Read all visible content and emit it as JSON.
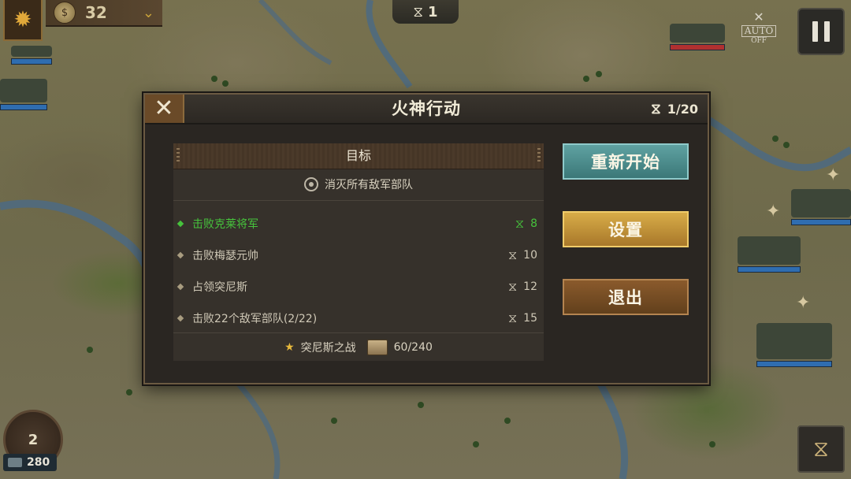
{
  "hud": {
    "coins": "32",
    "turn": "1",
    "auto_label": "AUTO",
    "auto_state": "OFF",
    "level": "2",
    "bottom_count": "280"
  },
  "icons": {
    "sun": "sun-icon",
    "coin": "coin-icon",
    "chevron": "chevron-down-icon",
    "hourglass": "hourglass-icon",
    "rifles": "crossed-rifles-icon",
    "pause": "pause-icon",
    "close": "close-icon",
    "target": "target-icon",
    "star": "star-icon",
    "chest": "chest-icon"
  },
  "dialog": {
    "title": "火神行动",
    "turns": "1/20",
    "objectives_header": "目标",
    "main_objective": "消灭所有敌军部队",
    "objectives": [
      {
        "label": "击败克莱将军",
        "turn": "8",
        "done": true
      },
      {
        "label": "击败梅瑟元帅",
        "turn": "10",
        "done": false
      },
      {
        "label": "占领突尼斯",
        "turn": "12",
        "done": false
      },
      {
        "label": "击败22个敌军部队(2/22)",
        "turn": "15",
        "done": false
      }
    ],
    "footer_battle": "突尼斯之战",
    "footer_progress": "60/240",
    "restart_label": "重新开始",
    "settings_label": "设置",
    "quit_label": "退出"
  },
  "colors": {
    "done_green": "#46c23c",
    "restart_teal": "#4a8c8c",
    "settings_gold": "#c4922e",
    "quit_brown": "#744c22"
  }
}
